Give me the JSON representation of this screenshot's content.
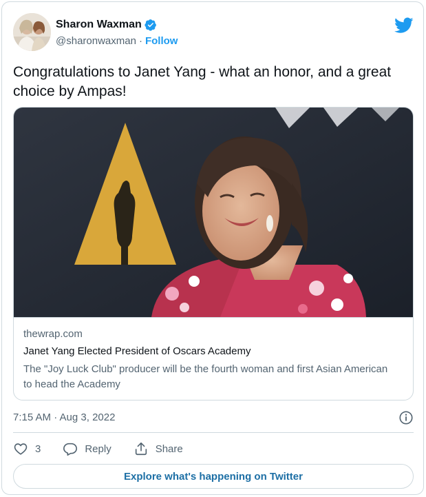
{
  "author": {
    "name": "Sharon Waxman",
    "handle": "@sharonwaxman",
    "separator": "·",
    "follow_label": "Follow"
  },
  "tweet": {
    "text": "Congratulations to Janet Yang - what an honor, and a great choice by Ampas!"
  },
  "link_card": {
    "domain": "thewrap.com",
    "title": "Janet Yang Elected President of Oscars Academy",
    "description": "The \"Joy Luck Club\" producer will be the fourth woman and first Asian American to head the Academy"
  },
  "timestamp": "7:15 AM · Aug 3, 2022",
  "actions": {
    "like_count": "3",
    "reply_label": "Reply",
    "share_label": "Share"
  },
  "explore_label": "Explore what's happening on Twitter",
  "colors": {
    "accent": "#1d9bf0",
    "text_primary": "#0f1419",
    "text_secondary": "#536471",
    "border": "#cfd9de"
  },
  "icons": {
    "verified": "verified-badge-icon",
    "brand": "twitter-bird-icon",
    "info": "info-icon",
    "like": "heart-icon",
    "reply": "reply-bubble-icon",
    "share": "share-icon"
  }
}
